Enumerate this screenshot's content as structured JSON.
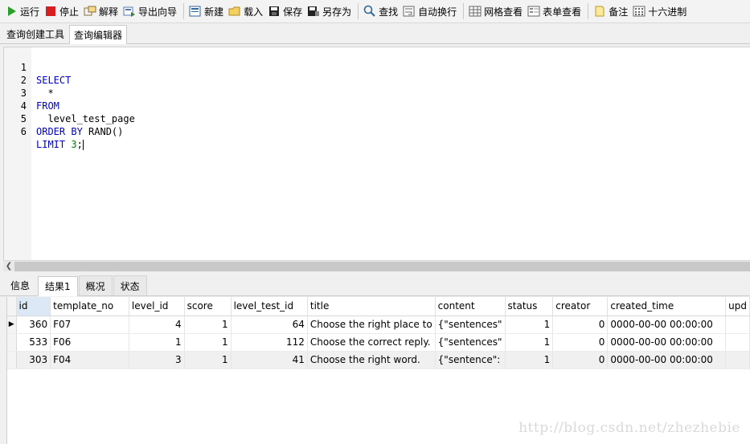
{
  "toolbar": {
    "buttons": [
      {
        "label": "运行",
        "icon": "play-icon"
      },
      {
        "label": "停止",
        "icon": "stop-icon"
      },
      {
        "label": "解释",
        "icon": "explain-icon"
      },
      {
        "label": "导出向导",
        "icon": "export-icon"
      },
      {
        "label": "新建",
        "icon": "new-icon"
      },
      {
        "label": "载入",
        "icon": "folder-icon"
      },
      {
        "label": "保存",
        "icon": "save-icon"
      },
      {
        "label": "另存为",
        "icon": "save-as-icon"
      },
      {
        "label": "查找",
        "icon": "search-icon"
      },
      {
        "label": "自动换行",
        "icon": "wrap-icon"
      },
      {
        "label": "网格查看",
        "icon": "grid-icon"
      },
      {
        "label": "表单查看",
        "icon": "form-icon"
      },
      {
        "label": "备注",
        "icon": "note-icon"
      },
      {
        "label": "十六进制",
        "icon": "hex-icon"
      }
    ]
  },
  "doc_tabs": [
    "查询创建工具",
    "查询编辑器"
  ],
  "editor": {
    "lines": [
      "SELECT",
      "  *",
      "FROM",
      "  level_test_page",
      "ORDER BY RAND()",
      "LIMIT 3;"
    ]
  },
  "result_tabs": [
    "信息",
    "结果1",
    "概况",
    "状态"
  ],
  "grid": {
    "columns": [
      "id",
      "template_no",
      "level_id",
      "score",
      "level_test_id",
      "title",
      "content",
      "status",
      "creator",
      "created_time",
      "upd"
    ],
    "rows": [
      [
        "360",
        "F07",
        "4",
        "1",
        "64",
        "Choose the right place to",
        "{\"sentences\"",
        "1",
        "0",
        "0000-00-00 00:00:00",
        ""
      ],
      [
        "533",
        "F06",
        "1",
        "1",
        "112",
        "Choose the correct reply.",
        "{\"sentences\"",
        "1",
        "0",
        "0000-00-00 00:00:00",
        ""
      ],
      [
        "303",
        "F04",
        "3",
        "1",
        "41",
        "Choose the right word.",
        "{\"sentence\":",
        "1",
        "0",
        "0000-00-00 00:00:00",
        ""
      ]
    ]
  },
  "watermark": "http://blog.csdn.net/zhezhebie",
  "colors": {
    "keyword": "#0000cc",
    "number": "#008000",
    "selected_header": "#dce8f5"
  }
}
